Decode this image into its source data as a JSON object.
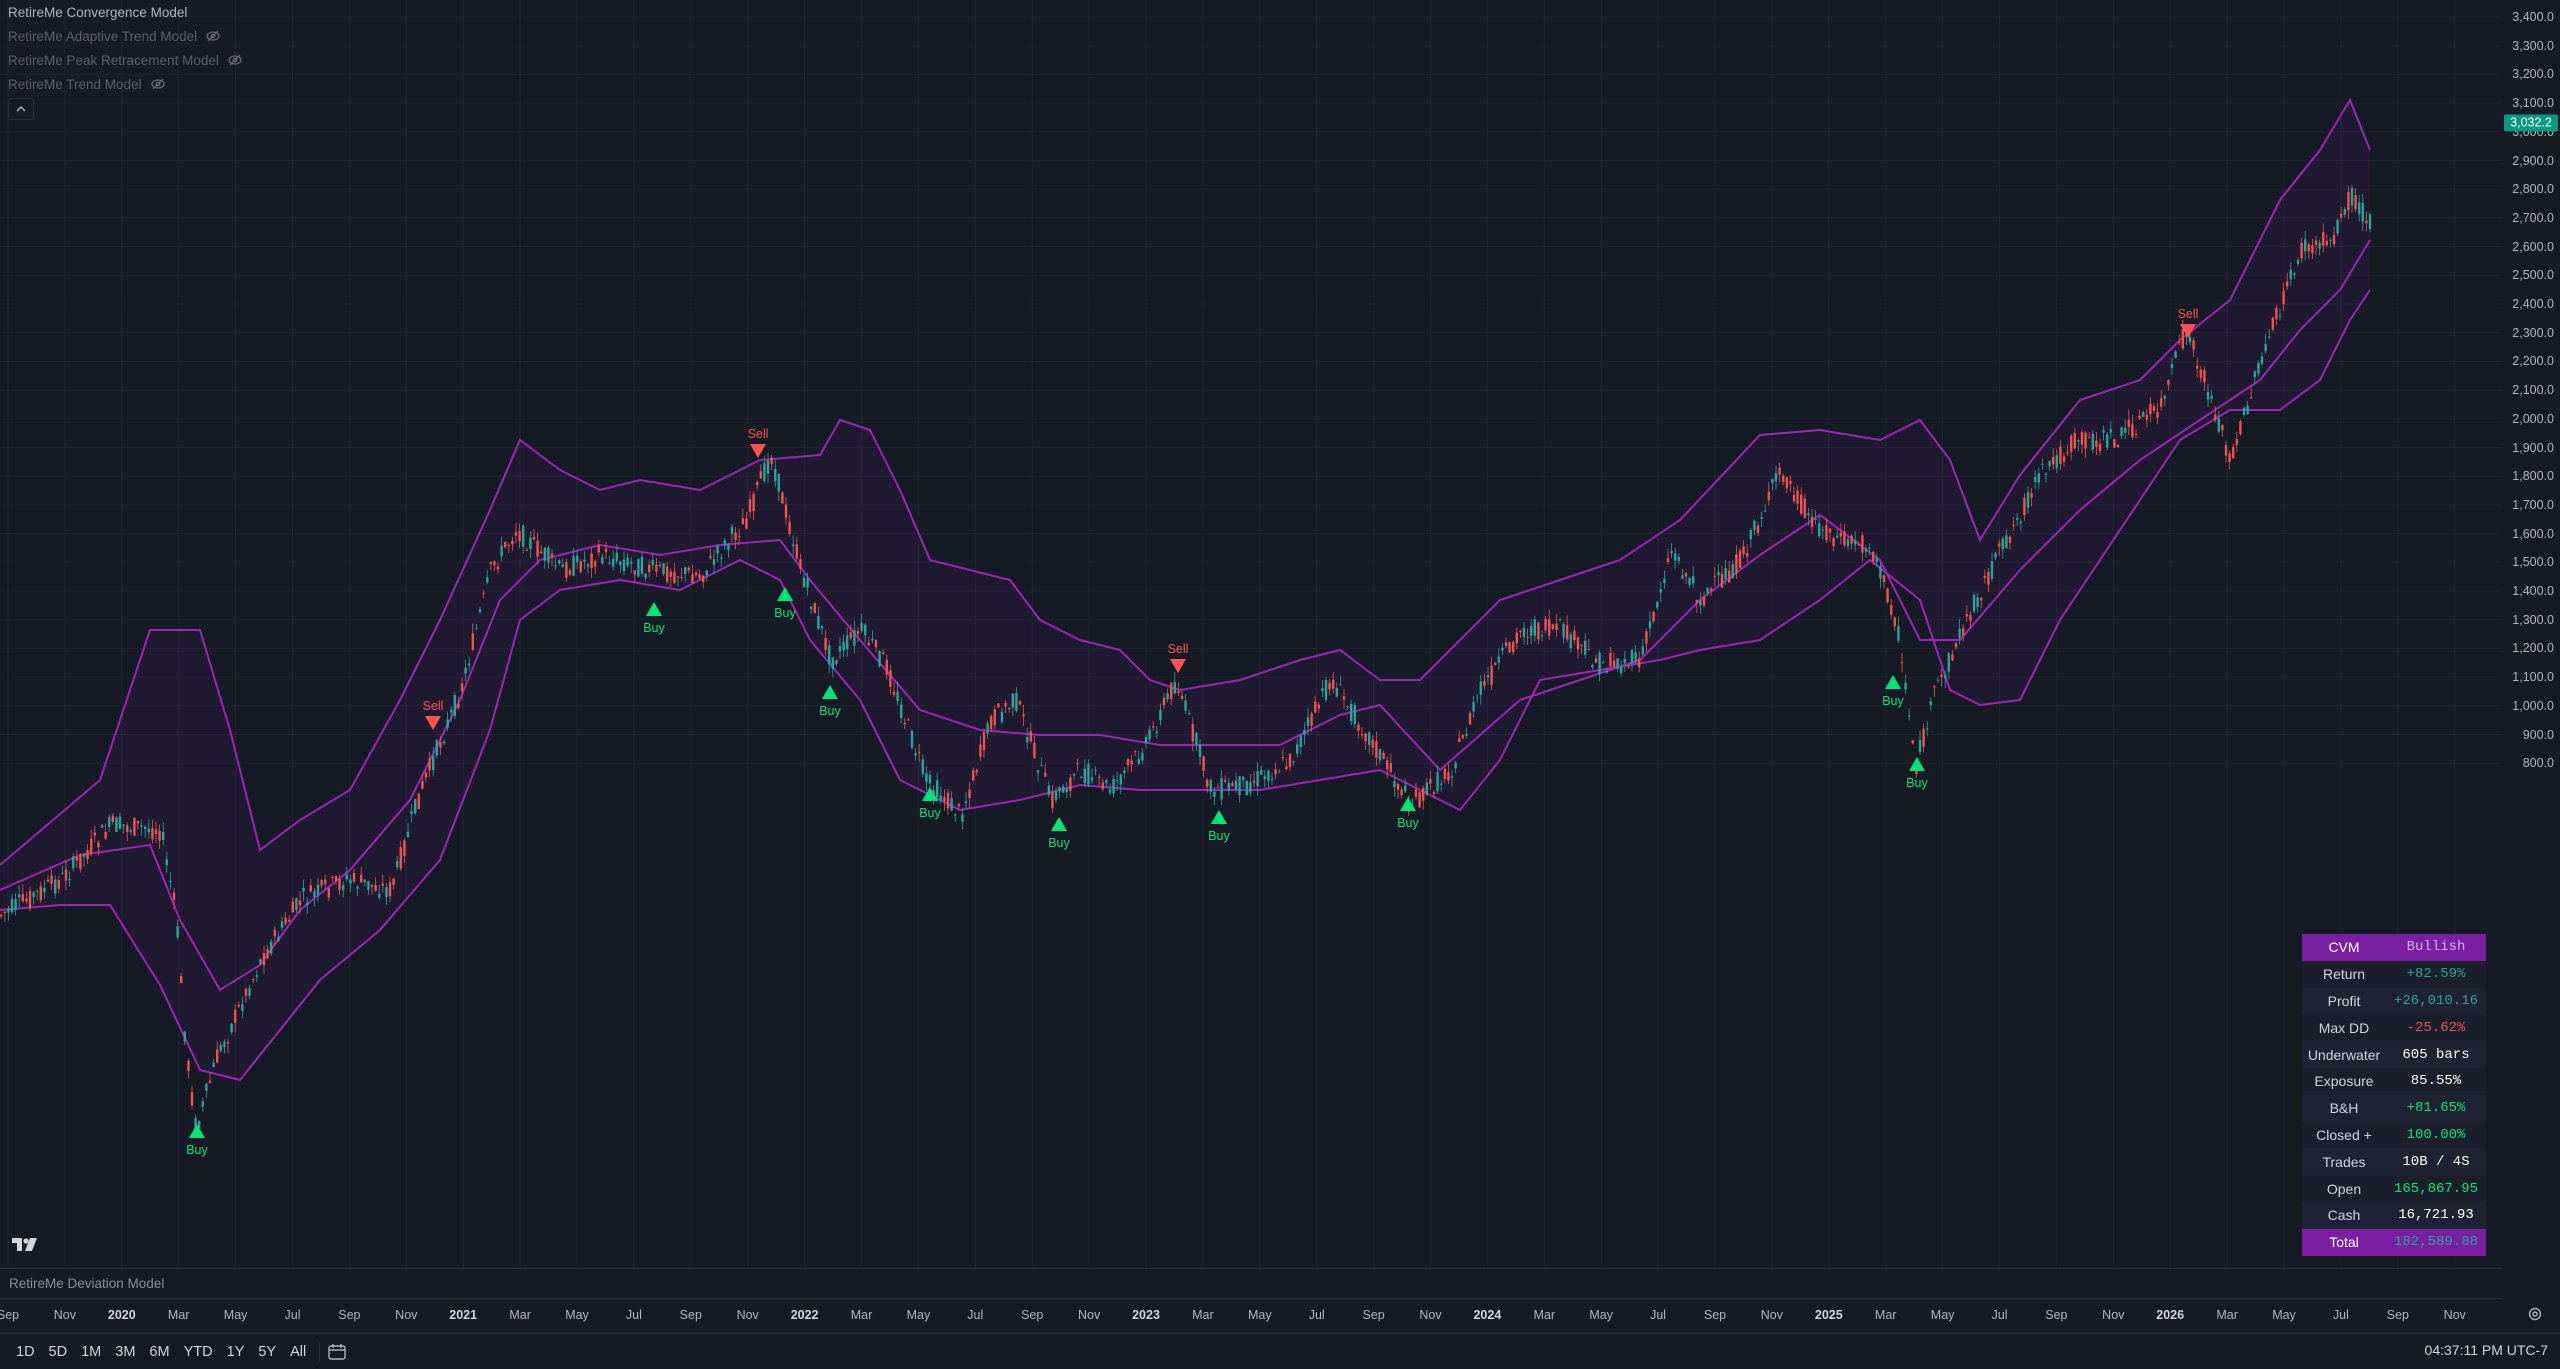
{
  "legend": {
    "items": [
      {
        "label": "RetireMe Convergence Model"
      },
      {
        "label": "RetireMe Adaptive Trend Model"
      },
      {
        "label": "RetireMe Peak Retracement Model"
      },
      {
        "label": "RetireMe Trend Model"
      }
    ]
  },
  "price_axis": {
    "ticks": [
      "3,400.0",
      "3,300.0",
      "3,200.0",
      "3,100.0",
      "3,000.0",
      "2,900.0",
      "2,800.0",
      "2,700.0",
      "2,600.0",
      "2,500.0",
      "2,400.0",
      "2,300.0",
      "2,200.0",
      "2,100.0",
      "2,000.0",
      "1,900.0",
      "1,800.0",
      "1,700.0",
      "1,600.0",
      "1,500.0",
      "1,400.0",
      "1,300.0",
      "1,200.0",
      "1,100.0",
      "1,000.0",
      "900.0",
      "800.0"
    ],
    "last_price": "3,032.2",
    "last_price_value": 3032.2
  },
  "time_axis": {
    "labels": [
      "Sep",
      "Nov",
      "2020",
      "Mar",
      "May",
      "Jul",
      "Sep",
      "Nov",
      "2021",
      "Mar",
      "May",
      "Jul",
      "Sep",
      "Nov",
      "2022",
      "Mar",
      "May",
      "Jul",
      "Sep",
      "Nov",
      "2023",
      "Mar",
      "May",
      "Jul",
      "Sep",
      "Nov",
      "2024",
      "Mar",
      "May",
      "Jul",
      "Sep",
      "Nov",
      "2025",
      "Mar",
      "May",
      "Jul",
      "Sep",
      "Nov",
      "2026",
      "Mar",
      "May",
      "Jul",
      "Sep",
      "Nov"
    ]
  },
  "subpane": {
    "title": "RetireMe Deviation Model"
  },
  "toolbar": {
    "ranges": [
      "1D",
      "5D",
      "1M",
      "3M",
      "6M",
      "YTD",
      "1Y",
      "5Y",
      "All"
    ],
    "clock": "04:37:11 PM UTC-7"
  },
  "signals": {
    "buy": "Buy",
    "sell": "Sell"
  },
  "stats": {
    "header": {
      "label": "CVM",
      "value": "Bullish"
    },
    "rows": [
      {
        "label": "Return",
        "value": "+82.59%",
        "color": "#26a69a"
      },
      {
        "label": "Profit",
        "value": "+26,010.16",
        "color": "#26a69a"
      },
      {
        "label": "Max DD",
        "value": "-25.62%",
        "color": "#ef5350"
      },
      {
        "label": "Underwater",
        "value": "605 bars",
        "color": "#ffffff"
      },
      {
        "label": "Exposure",
        "value": "85.55%",
        "color": "#ffffff"
      },
      {
        "label": "B&H",
        "value": "+81.65%",
        "color": "#00e676"
      },
      {
        "label": "Closed +",
        "value": "100.00%",
        "color": "#00e676"
      },
      {
        "label": "Trades",
        "value": "10B / 4S",
        "color": "#ffffff"
      },
      {
        "label": "Open",
        "value": "165,867.95",
        "color": "#00e676"
      },
      {
        "label": "Cash",
        "value": "16,721.93",
        "color": "#ffffff"
      }
    ],
    "total": {
      "label": "Total",
      "value": "182,589.88"
    }
  },
  "colors": {
    "background": "#161a25",
    "up": "#26a69a",
    "down": "#ef5350",
    "band": "#9c27b0",
    "buy": "#00e676",
    "sell": "#ff5252"
  }
}
